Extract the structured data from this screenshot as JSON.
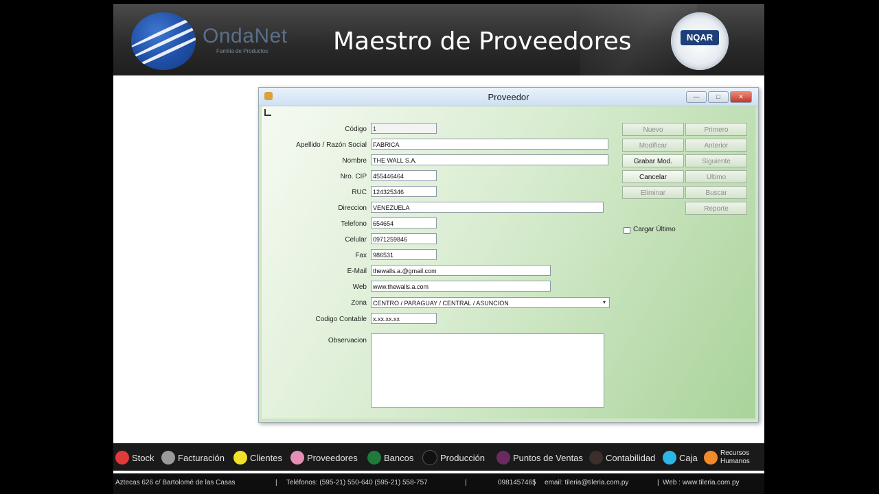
{
  "header": {
    "brand": "OndaNet",
    "brand_sub": "Familia de Productos",
    "title": "Maestro de Proveedores",
    "cert_badge": "NQAR"
  },
  "window": {
    "title": "Proveedor",
    "controls": {
      "minimize": "—",
      "maximize": "□",
      "close": "✕"
    }
  },
  "form": {
    "codigo": {
      "label": "Código",
      "value": "1"
    },
    "apellido": {
      "label": "Apellido / Razón Social",
      "value": "FABRICA"
    },
    "nombre": {
      "label": "Nombre",
      "value": "THE WALL S.A."
    },
    "nro_cip": {
      "label": "Nro. CIP",
      "value": "455446464"
    },
    "ruc": {
      "label": "RUC",
      "value": "124325346"
    },
    "direccion": {
      "label": "Direccion",
      "value": "VENEZUELA"
    },
    "telefono": {
      "label": "Telefono",
      "value": "654654"
    },
    "celular": {
      "label": "Celular",
      "value": "0971259846"
    },
    "fax": {
      "label": "Fax",
      "value": "986531"
    },
    "email": {
      "label": "E-Mail",
      "value": "thewalls.a.@gmail.com"
    },
    "web": {
      "label": "Web",
      "value": "www.thewalls.a.com"
    },
    "zona": {
      "label": "Zona",
      "value": "CENTRO / PARAGUAY / CENTRAL / ASUNCION"
    },
    "codigo_contable": {
      "label": "Codigo Contable",
      "value": "x.xx.xx.xx"
    },
    "observacion": {
      "label": "Observacion",
      "value": ""
    }
  },
  "buttons": {
    "nuevo": "Nuevo",
    "modificar": "Modificar",
    "grabar": "Grabar Mod.",
    "cancelar": "Cancelar",
    "eliminar": "Eliminar",
    "primero": "Primero",
    "anterior": "Anterior",
    "siguiente": "Siguiente",
    "ultimo": "Ultimo",
    "buscar": "Buscar",
    "reporte": "Reporte"
  },
  "cargar_ultimo": {
    "label": "Cargar Último",
    "checked": false
  },
  "footer_menu": [
    {
      "label": "Stock",
      "color": "#e03a3a"
    },
    {
      "label": "Facturación",
      "color": "#9a9a9a"
    },
    {
      "label": "Clientes",
      "color": "#f2e12a"
    },
    {
      "label": "Proveedores",
      "color": "#e68fb6"
    },
    {
      "label": "Bancos",
      "color": "#1f7a3c"
    },
    {
      "label": "Producción",
      "color": "#111111"
    },
    {
      "label": "Puntos de Ventas",
      "color": "#6a2a5f"
    },
    {
      "label": "Contabilidad",
      "color": "#3a2f2a"
    },
    {
      "label": "Caja",
      "color": "#2bb6e8"
    },
    {
      "label": "Recursos Humanos",
      "color": "#f08a2a"
    }
  ],
  "footer_info": {
    "address": "Aztecas 626 c/ Bartolomé de las Casas",
    "phones": "Teléfonos: (595-21) 550-640  (595-21) 558-757",
    "mobile": "0981457465",
    "email": "email: tileria@tileria.com.py",
    "web": "Web : www.tileria.com.py"
  }
}
